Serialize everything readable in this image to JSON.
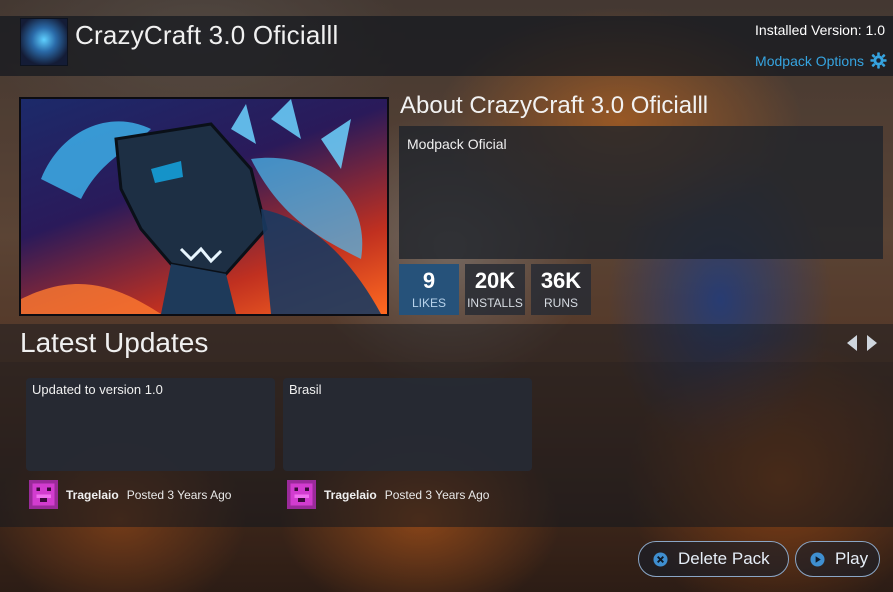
{
  "header": {
    "title": "CrazyCraft 3.0 Oficialll",
    "installed_version": "Installed Version: 1.0",
    "options_label": "Modpack Options",
    "icon": "pack-logo-icon"
  },
  "about": {
    "title": "About CrazyCraft 3.0 Oficialll",
    "description": "Modpack Oficial"
  },
  "stats": [
    {
      "value": "9",
      "label": "LIKES"
    },
    {
      "value": "20K",
      "label": "INSTALLS"
    },
    {
      "value": "36K",
      "label": "RUNS"
    }
  ],
  "updates": {
    "title": "Latest Updates",
    "items": [
      {
        "text": "Updated to version 1.0",
        "author": "Tragelaio",
        "posted": "Posted 3 Years Ago"
      },
      {
        "text": "Brasil",
        "author": "Tragelaio",
        "posted": "Posted 3 Years Ago"
      }
    ]
  },
  "actions": {
    "delete_label": "Delete Pack",
    "play_label": "Play"
  },
  "colors": {
    "accent": "#36a4e0",
    "likes_bg": "#26527a",
    "avatar": "#d23ccf"
  }
}
